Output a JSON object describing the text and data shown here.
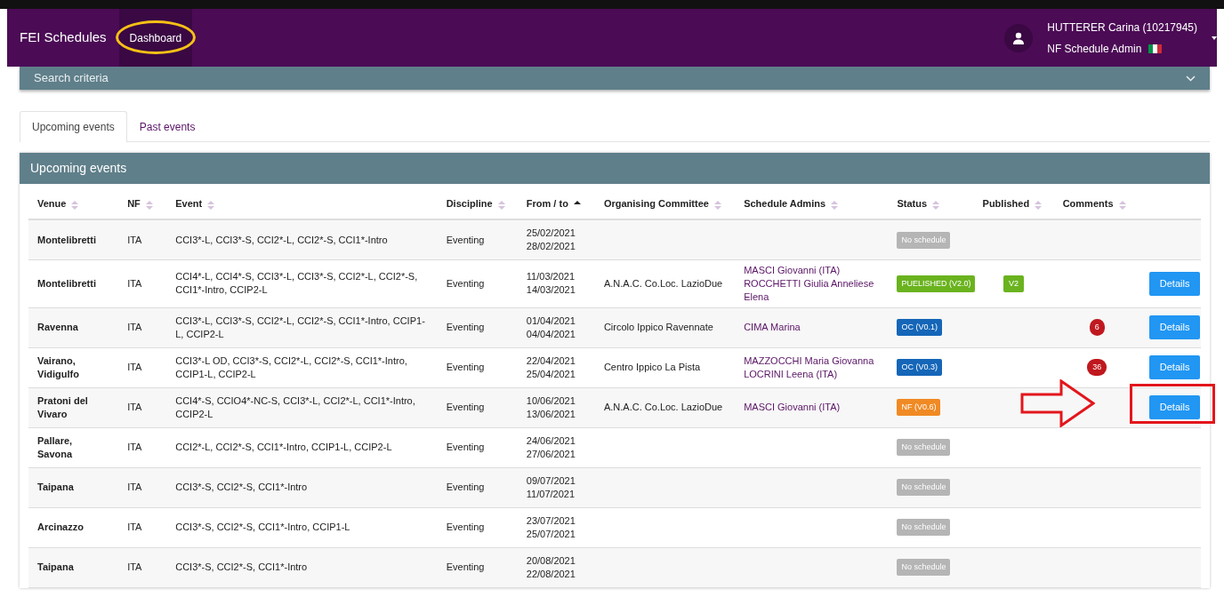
{
  "navbar": {
    "brand": "FEI Schedules",
    "items": [
      {
        "label": "Dashboard",
        "selected": true
      }
    ],
    "user": {
      "name": "HUTTERER Carina (10217945)",
      "role": "NF Schedule Admin"
    }
  },
  "search": {
    "title": "Search criteria",
    "expanded": false
  },
  "tabs": [
    {
      "label": "Upcoming events",
      "selected": true
    },
    {
      "label": "Past events",
      "selected": false
    }
  ],
  "panel": {
    "title": "Upcoming events"
  },
  "table": {
    "columns": [
      {
        "label": "Venue",
        "sorted": false
      },
      {
        "label": "NF",
        "sorted": false
      },
      {
        "label": "Event",
        "sorted": false
      },
      {
        "label": "Discipline",
        "sorted": false
      },
      {
        "label": "From / to",
        "sorted": true
      },
      {
        "label": "Organising Committee",
        "sorted": false
      },
      {
        "label": "Schedule Admins",
        "sorted": false
      },
      {
        "label": "Status",
        "sorted": false
      },
      {
        "label": "Published",
        "sorted": false
      },
      {
        "label": "Comments",
        "sorted": false
      }
    ],
    "rows": [
      {
        "venue": "Montelibretti",
        "nf": "ITA",
        "event": "CCI3*-L, CCI3*-S, CCI2*-L, CCI2*-S, CCI1*-Intro",
        "discipline": "Eventing",
        "from": "25/02/2021",
        "to": "28/02/2021",
        "status": {
          "text": "No schedule",
          "kind": "none"
        }
      },
      {
        "venue": "Montelibretti",
        "nf": "ITA",
        "event": "CCI4*-L, CCI4*-S, CCI3*-L, CCI3*-S, CCI2*-L, CCI2*-S, CCI1*-Intro, CCIP2-L",
        "discipline": "Eventing",
        "from": "11/03/2021",
        "to": "14/03/2021",
        "committee": "A.N.A.C. Co.Loc. LazioDue",
        "admins": [
          "MASCI Giovanni (ITA)",
          "ROCCHETTI Giulia Anneliese Elena"
        ],
        "status": {
          "text": "PUELISHED (V2.0)",
          "kind": "published"
        },
        "published": "V2",
        "action": "Details"
      },
      {
        "venue": "Ravenna",
        "nf": "ITA",
        "event": "CCI3*-L, CCI3*-S, CCI2*-L, CCI2*-S, CCI1*-Intro, CCIP1-L, CCIP2-L",
        "discipline": "Eventing",
        "from": "01/04/2021",
        "to": "04/04/2021",
        "committee": "Circolo Ippico Ravennate",
        "admins": [
          "CIMA Marina"
        ],
        "status": {
          "text": "OC (V0.1)",
          "kind": "oc"
        },
        "comments": "6",
        "action": "Details"
      },
      {
        "venue": "Vairano, Vidigulfo",
        "nf": "ITA",
        "event": "CCI3*-L OD, CCI3*-S, CCI2*-L, CCI2*-S, CCI1*-Intro, CCIP1-L, CCIP2-L",
        "discipline": "Eventing",
        "from": "22/04/2021",
        "to": "25/04/2021",
        "committee": "Centro Ippico La Pista",
        "admins": [
          "MAZZOCCHI Maria Giovanna",
          "LOCRINI Leena (ITA)"
        ],
        "status": {
          "text": "OC (V0.3)",
          "kind": "oc"
        },
        "comments": "36",
        "action": "Details"
      },
      {
        "venue": "Pratoni del Vivaro",
        "nf": "ITA",
        "event": "CCI4*-S, CCIO4*-NC-S, CCI3*-L, CCI2*-L, CCI1*-Intro, CCIP2-L",
        "discipline": "Eventing",
        "from": "10/06/2021",
        "to": "13/06/2021",
        "committee": "A.N.A.C. Co.Loc. LazioDue",
        "admins": [
          "MASCI Giovanni (ITA)"
        ],
        "status": {
          "text": "NF (V0.6)",
          "kind": "nf"
        },
        "action": "Details",
        "highlighted": true
      },
      {
        "venue": "Pallare, Savona",
        "nf": "ITA",
        "event": "CCI2*-L, CCI2*-S, CCI1*-Intro, CCIP1-L, CCIP2-L",
        "discipline": "Eventing",
        "from": "24/06/2021",
        "to": "27/06/2021",
        "status": {
          "text": "No schedule",
          "kind": "none"
        }
      },
      {
        "venue": "Taipana",
        "nf": "ITA",
        "event": "CCI3*-S, CCI2*-S, CCI1*-Intro",
        "discipline": "Eventing",
        "from": "09/07/2021",
        "to": "11/07/2021",
        "status": {
          "text": "No schedule",
          "kind": "none"
        }
      },
      {
        "venue": "Arcinazzo",
        "nf": "ITA",
        "event": "CCI3*-S, CCI2*-S, CCI1*-Intro, CCIP1-L",
        "discipline": "Eventing",
        "from": "23/07/2021",
        "to": "25/07/2021",
        "status": {
          "text": "No schedule",
          "kind": "none"
        }
      },
      {
        "venue": "Taipana",
        "nf": "ITA",
        "event": "CCI3*-S, CCI2*-S, CCI1*-Intro",
        "discipline": "Eventing",
        "from": "20/08/2021",
        "to": "22/08/2021",
        "status": {
          "text": "No schedule",
          "kind": "none"
        }
      }
    ]
  }
}
